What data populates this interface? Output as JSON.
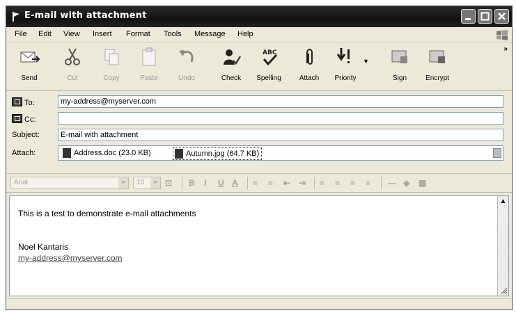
{
  "window": {
    "title": "E-mail with attachment",
    "app_icon": "flag-icon"
  },
  "menu": [
    "File",
    "Edit",
    "View",
    "Insert",
    "Format",
    "Tools",
    "Message",
    "Help"
  ],
  "toolbar": {
    "send": "Send",
    "cut": "Cut",
    "copy": "Copy",
    "paste": "Paste",
    "undo": "Undo",
    "check": "Check",
    "spelling": "Spelling",
    "attach": "Attach",
    "priority": "Priority",
    "sign": "Sign",
    "encrypt": "Encrypt",
    "more": "»"
  },
  "header": {
    "to_label": "To:",
    "to_value": "my-address@myserver.com",
    "cc_label": "Cc:",
    "cc_value": "",
    "subject_label": "Subject:",
    "subject_value": "E-mail with attachment",
    "attach_label": "Attach:",
    "attachments": [
      "Address.doc (23.0 KB)",
      "Autumn.jpg (64.7 KB)"
    ]
  },
  "format": {
    "font": "Arial",
    "size": "10"
  },
  "body": {
    "line1": "This is a test to demonstrate e-mail attachments",
    "sig_name": "Noel Kantaris",
    "sig_link": "my-address@myserver.com"
  },
  "colors": {
    "titlebar": "#1a1a1a",
    "chrome": "#ece9d8",
    "field_border": "#7f9db9"
  }
}
